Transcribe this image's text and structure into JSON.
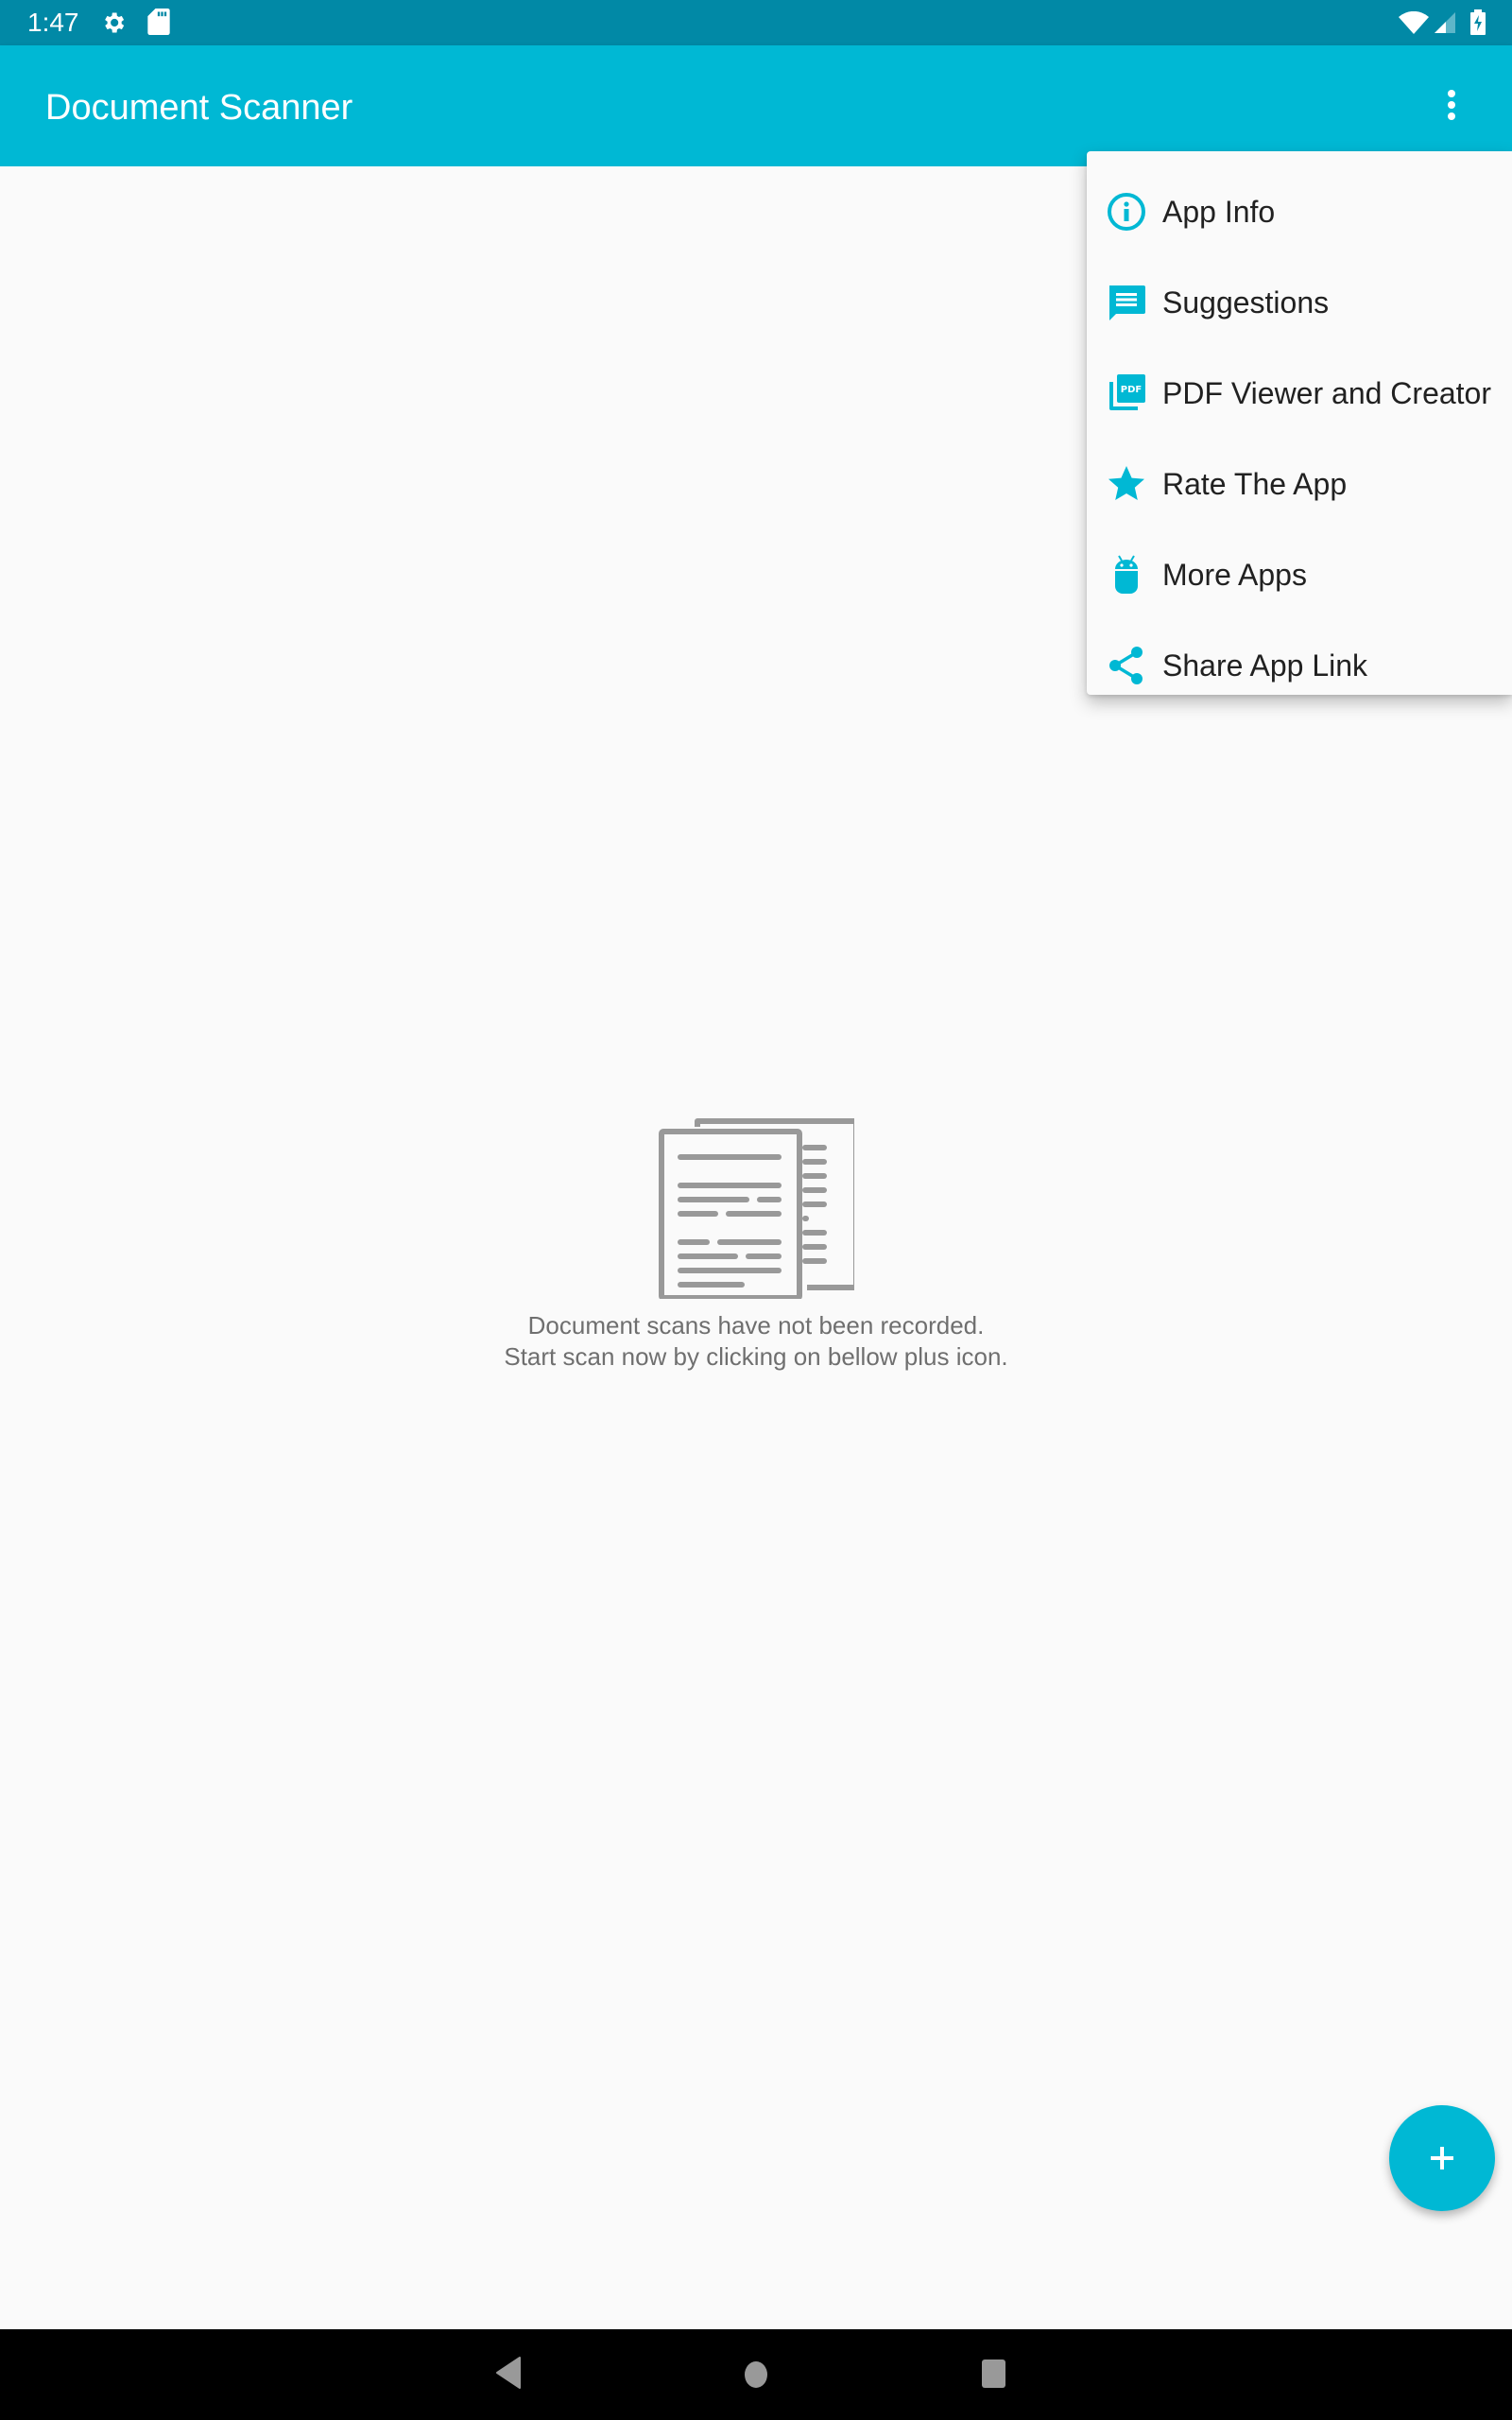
{
  "status_bar": {
    "time": "1:47",
    "left_icons": [
      "settings-icon",
      "sd-card-icon"
    ],
    "right_icons": [
      "wifi-icon",
      "cell-signal-icon",
      "battery-charging-icon"
    ]
  },
  "app_bar": {
    "title": "Document Scanner",
    "overflow_icon": "more-vert-icon"
  },
  "overflow_menu": {
    "items": [
      {
        "label": "App Info",
        "icon": "info-icon"
      },
      {
        "label": "Suggestions",
        "icon": "message-icon"
      },
      {
        "label": "PDF Viewer and Creator",
        "icon": "pdf-icon"
      },
      {
        "label": "Rate The App",
        "icon": "star-icon"
      },
      {
        "label": "More Apps",
        "icon": "android-icon"
      },
      {
        "label": "Share App Link",
        "icon": "share-icon"
      }
    ]
  },
  "empty_state": {
    "icon": "documents-icon",
    "line1": "Document scans have not been recorded.",
    "line2": "Start scan now by clicking on bellow plus icon."
  },
  "fab": {
    "icon": "plus-icon"
  },
  "nav_bar": {
    "buttons": [
      "back",
      "home",
      "recents"
    ]
  },
  "colors": {
    "primary": "#00b8d4",
    "primary_dark": "#0189a6",
    "background": "#fafafa",
    "menu_text": "#212121",
    "empty_text": "#6f6f6f",
    "illustration": "#999999"
  }
}
